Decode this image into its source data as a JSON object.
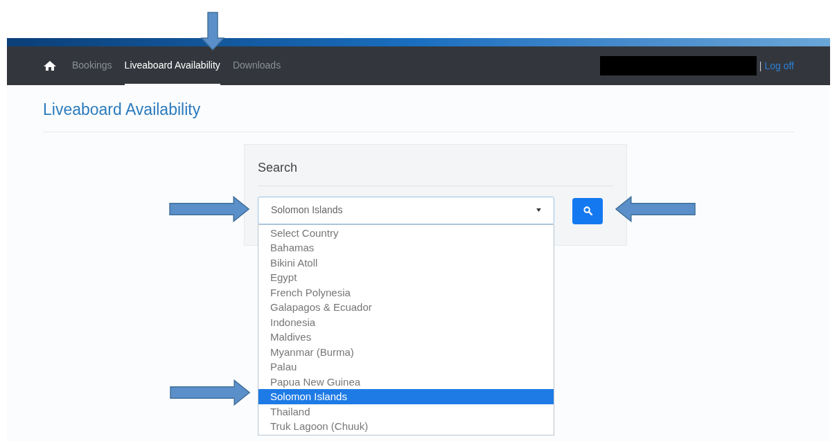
{
  "nav": {
    "items": [
      {
        "label": "Bookings",
        "selected": false
      },
      {
        "label": "Liveaboard Availability",
        "selected": true
      },
      {
        "label": "Downloads",
        "selected": false
      }
    ],
    "separator": "|",
    "logoff": "Log off"
  },
  "page_title": "Liveaboard Availability",
  "search_panel": {
    "title": "Search",
    "country_select": {
      "value": "Solomon Islands",
      "expanded": true,
      "options": [
        {
          "label": "Select Country",
          "selected": false
        },
        {
          "label": "Bahamas",
          "selected": false
        },
        {
          "label": "Bikini Atoll",
          "selected": false
        },
        {
          "label": "Egypt",
          "selected": false
        },
        {
          "label": "French Polynesia",
          "selected": false
        },
        {
          "label": "Galapagos & Ecuador",
          "selected": false
        },
        {
          "label": "Indonesia",
          "selected": false
        },
        {
          "label": "Maldives",
          "selected": false
        },
        {
          "label": "Myanmar (Burma)",
          "selected": false
        },
        {
          "label": "Palau",
          "selected": false
        },
        {
          "label": "Papua New Guinea",
          "selected": false
        },
        {
          "label": "Solomon Islands",
          "selected": true
        },
        {
          "label": "Thailand",
          "selected": false
        },
        {
          "label": "Truk Lagoon (Chuuk)",
          "selected": false
        }
      ]
    }
  }
}
